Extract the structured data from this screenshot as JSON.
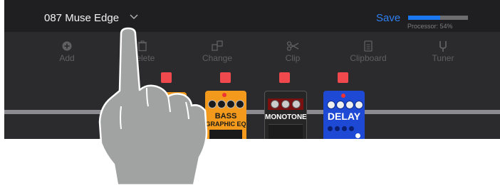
{
  "header": {
    "preset_name": "087 Muse Edge",
    "save_label": "Save",
    "processor_label": "Processor: 54%",
    "processor_percent": 54
  },
  "toolbar": {
    "items": [
      {
        "label": "Add",
        "icon": "plus-circle-icon"
      },
      {
        "label": "Delete",
        "icon": "trash-icon"
      },
      {
        "label": "Change",
        "icon": "swap-icon"
      },
      {
        "label": "Clip",
        "icon": "scissors-icon"
      },
      {
        "label": "Clipboard",
        "icon": "clipboard-icon"
      },
      {
        "label": "Tuner",
        "icon": "tuning-fork-icon"
      }
    ]
  },
  "pedals": [
    {
      "name_line1": "BASS",
      "name_line2": "GRAPHIC EQ",
      "color": "#f39a1c"
    },
    {
      "name_line1": "MONOTONE",
      "color": "#262626"
    },
    {
      "name_line1": "DELAY",
      "color": "#1e49d4"
    }
  ],
  "colors": {
    "accent": "#2f7ff0",
    "marker": "#f0494d",
    "header_bg": "#1f1f21",
    "body_bg": "#2b2b2d"
  }
}
